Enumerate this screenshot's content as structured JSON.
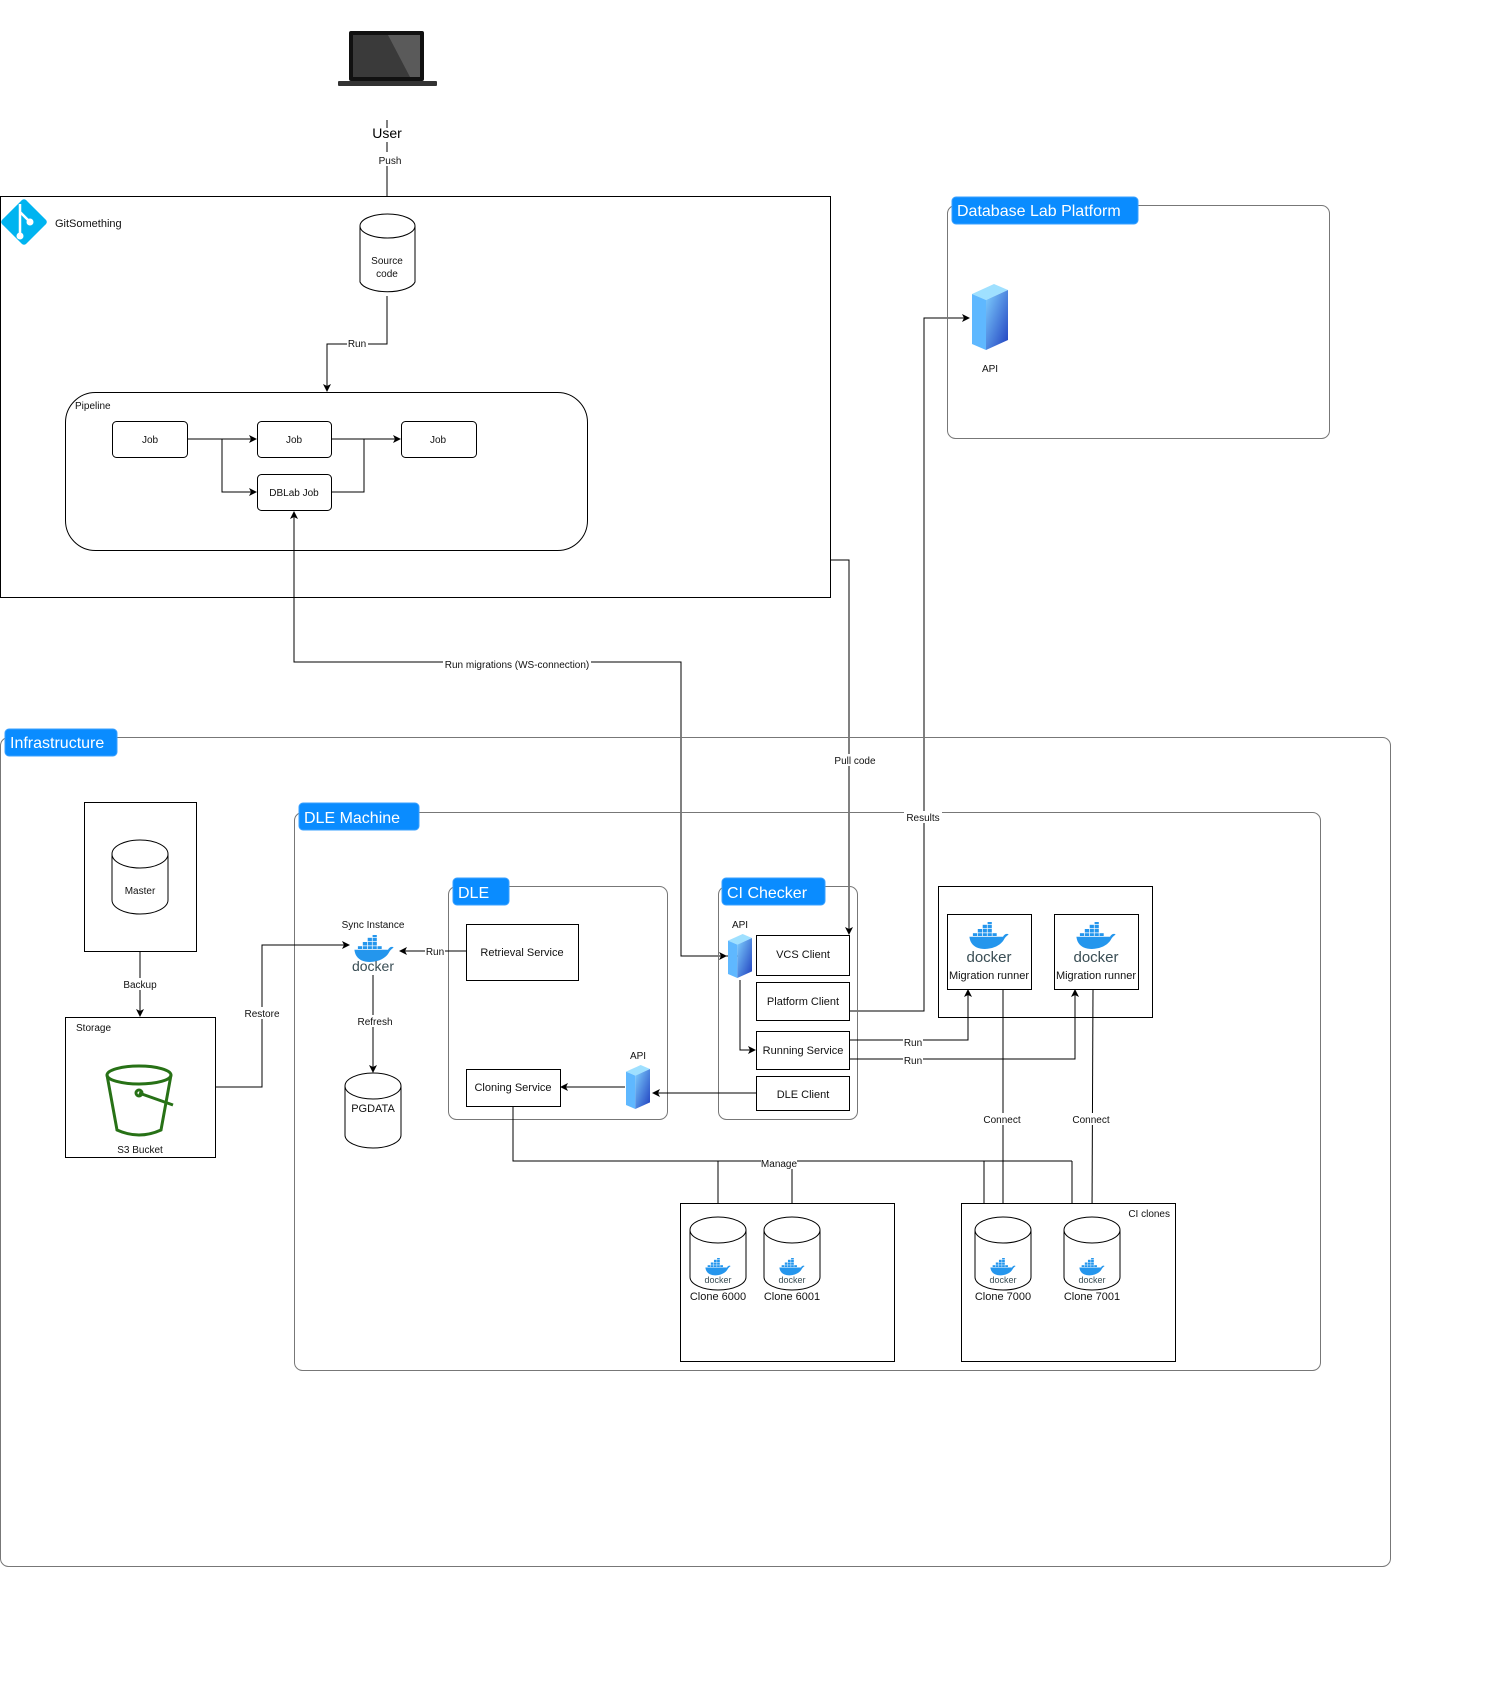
{
  "colors": {
    "badge": "#0A8CFF",
    "git_logo": "#00B4F0",
    "docker": "#2496ED",
    "bucket": "#277116",
    "server": "#3D6BDB"
  },
  "user": {
    "label": "User",
    "icon": "laptop-icon",
    "push_label": "Push"
  },
  "git": {
    "title": "GitSomething",
    "icon": "git-icon",
    "source_code": [
      "Source",
      "code"
    ],
    "run_label": "Run",
    "pipeline": {
      "title": "Pipeline",
      "jobs": [
        "Job",
        "Job",
        "Job"
      ],
      "dblab_job": "DBLab Job"
    }
  },
  "edges": {
    "run_migrations": "Run migrations (WS-connection)",
    "pull_code": "Pull code",
    "results": "Results",
    "backup": "Backup",
    "restore": "Restore",
    "refresh": "Refresh",
    "run": "Run",
    "connect": "Connect",
    "manage": "Manage"
  },
  "platform": {
    "title": "Database Lab Platform",
    "api_label": "API"
  },
  "infra": {
    "title": "Infrastructure",
    "master": "Master",
    "storage": "Storage",
    "s3": "S3 Bucket",
    "dle_machine": {
      "title": "DLE Machine",
      "sync_instance": "Sync Instance",
      "docker_text": "docker",
      "pgdata": "PGDATA",
      "dle": {
        "title": "DLE",
        "retrieval": "Retrieval Service",
        "cloning": "Cloning Service",
        "api_label": "API"
      },
      "ci_checker": {
        "title": "CI Checker",
        "api_label": "API",
        "vcs": "VCS Client",
        "platform_client": "Platform Client",
        "running": "Running Service",
        "dle_client": "DLE Client"
      },
      "runners": [
        {
          "docker_text": "docker",
          "label": "Migration runner"
        },
        {
          "docker_text": "docker",
          "label": "Migration runner"
        }
      ],
      "clones": [
        {
          "label": "Clone 6000",
          "docker_text": "docker"
        },
        {
          "label": "Clone 6001",
          "docker_text": "docker"
        }
      ],
      "ci_clones": {
        "title": "CI clones",
        "items": [
          {
            "label": "Clone 7000",
            "docker_text": "docker"
          },
          {
            "label": "Clone 7001",
            "docker_text": "docker"
          }
        ]
      }
    }
  }
}
